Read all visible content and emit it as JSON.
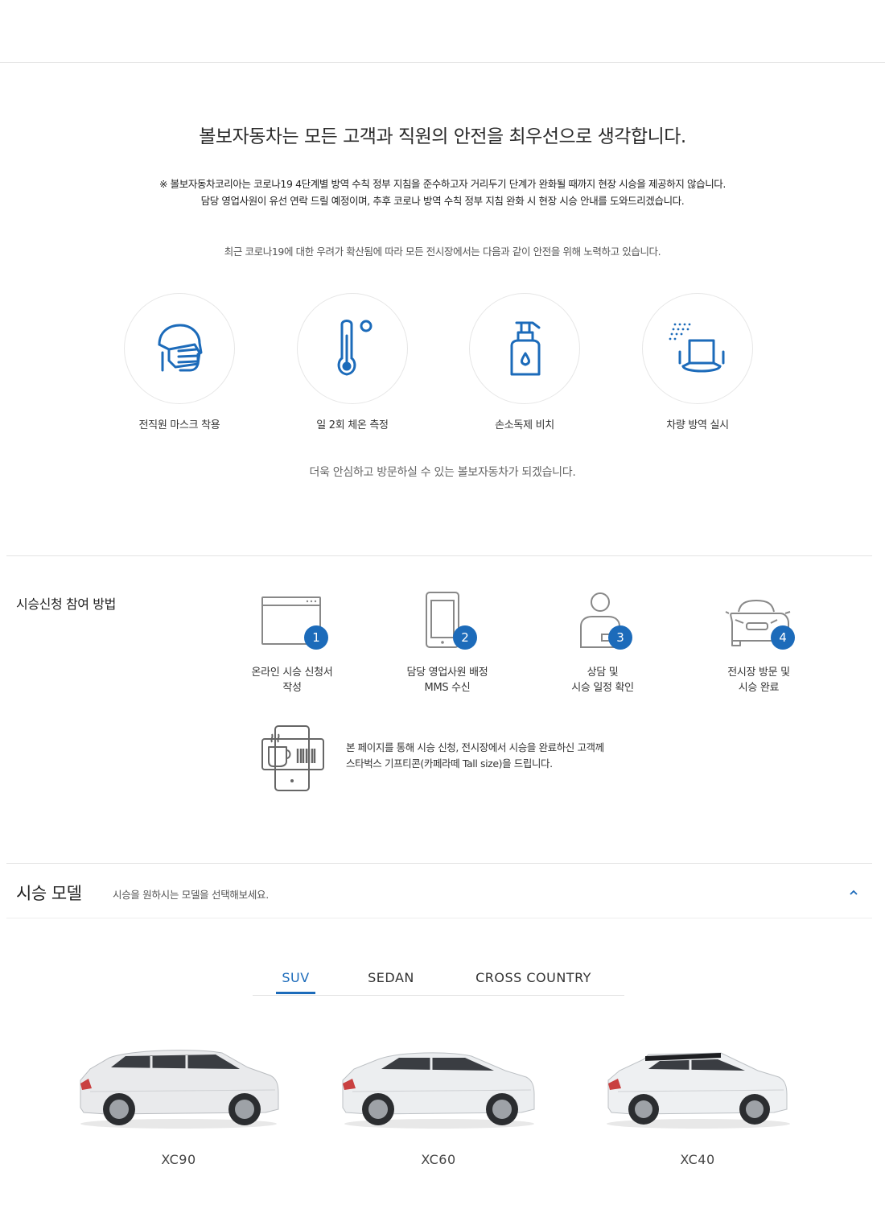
{
  "safety": {
    "title": "볼보자동차는 모든 고객과 직원의 안전을 최우선으로 생각합니다.",
    "notice_line1": "※ 볼보자동차코리아는 코로나19 4단계별 방역 수칙 정부 지침을 준수하고자 거리두기 단계가 완화될 때까지 현장 시승을 제공하지 않습니다.",
    "notice_line2": "담당 영업사원이 유선 연락 드릴 예정이며, 추후 코로나 방역 수칙 정부 지침 완화 시 현장 시승 안내를 도와드리겠습니다.",
    "intro": "최근 코로나19에 대한 우려가 확산됨에 따라 모든 전시장에서는 다음과 같이 안전을 위해 노력하고 있습니다.",
    "measures": [
      {
        "label": "전직원 마스크 착용",
        "icon": "face-mask-icon"
      },
      {
        "label": "일 2회 체온 측정",
        "icon": "thermometer-icon"
      },
      {
        "label": "손소독제 비치",
        "icon": "hand-sanitizer-icon"
      },
      {
        "label": "차량 방역 실시",
        "icon": "car-seat-disinfection-icon"
      }
    ],
    "closing": "더욱 안심하고 방문하실 수 있는 볼보자동차가 되겠습니다."
  },
  "participation": {
    "title": "시승신청 참여 방법",
    "steps": [
      {
        "number": "1",
        "line1": "온라인 시승 신청서",
        "line2": "작성",
        "icon": "browser-window-icon"
      },
      {
        "number": "2",
        "line1": "담당 영업사원 배정",
        "line2": "MMS 수신",
        "icon": "mobile-phone-icon"
      },
      {
        "number": "3",
        "line1": "상담 및",
        "line2": "시승 일정 확인",
        "icon": "consultant-icon"
      },
      {
        "number": "4",
        "line1": "전시장 방문 및",
        "line2": "시승 완료",
        "icon": "car-front-icon"
      }
    ],
    "gift_line1": "본 페이지를 통해 시승 신청, 전시장에서 시승을 완료하신 고객께",
    "gift_line2": "스타벅스 기프티콘(카페라떼 Tall size)을 드립니다.",
    "gift_icon": "coffee-giftcon-icon"
  },
  "models": {
    "title": "시승 모델",
    "subtitle": "시승을 원하시는 모델을 선택해보세요.",
    "collapse_icon": "chevron-up-icon",
    "tabs": [
      {
        "label": "SUV",
        "active": true
      },
      {
        "label": "SEDAN",
        "active": false
      },
      {
        "label": "CROSS COUNTRY",
        "active": false
      }
    ],
    "cars": [
      {
        "name": "XC90"
      },
      {
        "name": "XC60"
      },
      {
        "name": "XC40"
      }
    ]
  },
  "colors": {
    "accent": "#1c6bba",
    "icon_blue": "#1c6bba",
    "divider": "#e3e3e3"
  }
}
